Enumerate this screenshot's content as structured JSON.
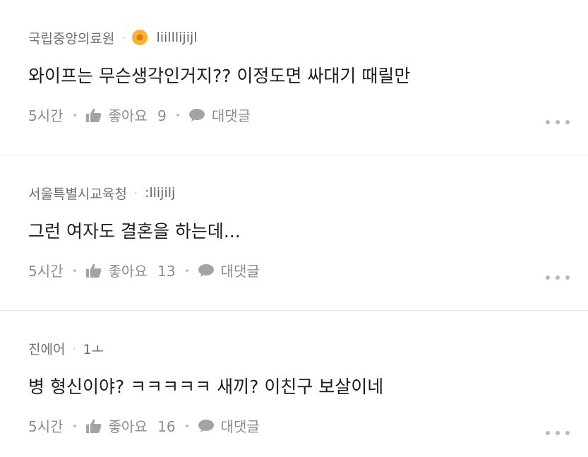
{
  "comments": [
    {
      "author": "국립중앙의료원",
      "nickname": "liilllijijl",
      "has_badge": true,
      "text": "와이프는 무슨생각인거지?? 이정도면 싸대기 때릴만",
      "time": "5시간",
      "like_label": "좋아요",
      "like_count": "9",
      "reply_label": "대댓글"
    },
    {
      "author": "서울특별시교육청",
      "nickname": ":llijilj",
      "has_badge": false,
      "text": "그런 여자도 결혼을 하는데...",
      "time": "5시간",
      "like_label": "좋아요",
      "like_count": "13",
      "reply_label": "대댓글"
    },
    {
      "author": "진에어",
      "nickname": "1ㅗ",
      "has_badge": false,
      "text": "병 형신이야? ㅋㅋㅋㅋㅋ 새끼? 이친구 보살이네",
      "time": "5시간",
      "like_label": "좋아요",
      "like_count": "16",
      "reply_label": "대댓글"
    }
  ],
  "icons": {
    "like": "thumbs-up-icon",
    "reply": "speech-bubble-icon",
    "badge": "flower-badge-icon",
    "more": "more-dots-icon"
  },
  "colors": {
    "badge": "#f6b42a",
    "text": "#1d1d1d",
    "muted": "#8c8c8c"
  }
}
